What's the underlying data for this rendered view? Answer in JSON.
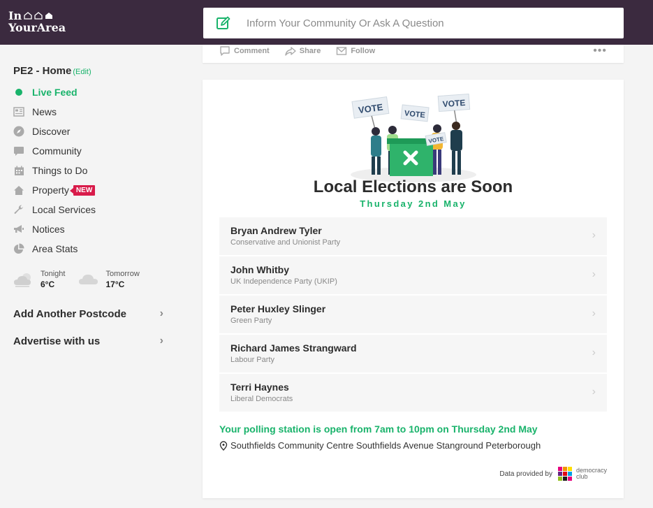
{
  "header": {
    "logo_line1": "In",
    "logo_line2": "YourArea",
    "post_placeholder": "Inform Your Community Or Ask A Question"
  },
  "sidebar": {
    "area": "PE2 - Home",
    "edit_label": "(Edit)",
    "items": [
      {
        "label": "Live Feed",
        "icon": "live-dot"
      },
      {
        "label": "News",
        "icon": "news-icon"
      },
      {
        "label": "Discover",
        "icon": "compass-icon"
      },
      {
        "label": "Community",
        "icon": "chat-bubble-icon"
      },
      {
        "label": "Things to Do",
        "icon": "calendar-icon"
      },
      {
        "label": "Property",
        "icon": "house-icon",
        "badge": "NEW"
      },
      {
        "label": "Local Services",
        "icon": "wrench-icon"
      },
      {
        "label": "Notices",
        "icon": "megaphone-icon"
      },
      {
        "label": "Area Stats",
        "icon": "pie-chart-icon"
      }
    ],
    "weather": {
      "tonight_label": "Tonight",
      "tonight_temp": "6°C",
      "tomorrow_label": "Tomorrow",
      "tomorrow_temp": "17°C"
    },
    "add_postcode": "Add Another Postcode",
    "advertise": "Advertise with us"
  },
  "post_actions": {
    "comment": "Comment",
    "share": "Share",
    "follow": "Follow"
  },
  "election": {
    "title": "Local Elections are Soon",
    "date": "Thursday 2nd May",
    "candidates": [
      {
        "name": "Bryan Andrew Tyler",
        "party": "Conservative and Unionist Party"
      },
      {
        "name": "John Whitby",
        "party": "UK Independence Party (UKIP)"
      },
      {
        "name": "Peter Huxley Slinger",
        "party": "Green Party"
      },
      {
        "name": "Richard James Strangward",
        "party": "Labour Party"
      },
      {
        "name": "Terri Haynes",
        "party": "Liberal Democrats"
      }
    ],
    "polling_hours": "Your polling station is open from 7am to 10pm on Thursday 2nd May",
    "polling_address": "Southfields Community Centre Southfields Avenue Stanground Peterborough",
    "credit_label": "Data provided by",
    "credit_org_line1": "democracy",
    "credit_org_line2": "club",
    "vote_sign": "VOTE"
  },
  "colors": {
    "header_bg": "#3b2a3f",
    "accent": "#19b36b",
    "badge": "#d81b4a"
  }
}
